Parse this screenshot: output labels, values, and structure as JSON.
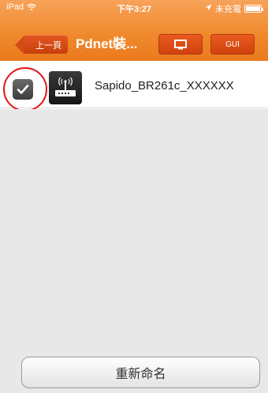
{
  "status_bar": {
    "carrier": "iPad",
    "time": "下午3:27",
    "charging": "未充電"
  },
  "nav": {
    "back_label": "上一頁",
    "title": "Pdnet裝...",
    "gui_label": "GUI",
    "screen_icon": "monitor-icon"
  },
  "devices": [
    {
      "name": "Sapido_BR261c_XXXXXX",
      "checked": true,
      "icon": "router-icon"
    }
  ],
  "footer": {
    "rename_label": "重新命名"
  },
  "colors": {
    "header": "#f08a2e",
    "button": "#d54a16",
    "highlight": "#e21414",
    "background": "#e8e8e8"
  }
}
